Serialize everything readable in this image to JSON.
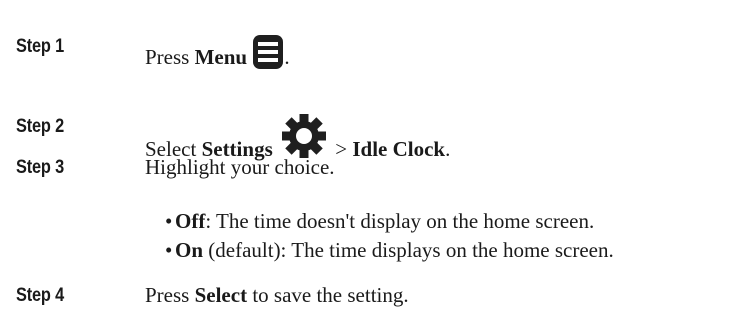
{
  "steps": [
    {
      "label": "Step 1",
      "prefix": "Press ",
      "bold": "Menu",
      "suffix": ".",
      "icon": "menu-icon"
    },
    {
      "label": "Step 2",
      "prefix": "Select ",
      "bold": "Settings",
      "middle": " > ",
      "bold2": "Idle Clock",
      "suffix": ".",
      "icon": "settings-gear-icon"
    },
    {
      "label": "Step 3",
      "text": "Highlight your choice.",
      "bullets": [
        {
          "bold": "Off",
          "text": ": The time doesn't display on the home screen."
        },
        {
          "bold": "On",
          "text": " (default): The time displays on the home screen."
        }
      ]
    },
    {
      "label": "Step 4",
      "prefix": "Press ",
      "bold": "Select",
      "suffix": " to save the setting."
    }
  ]
}
